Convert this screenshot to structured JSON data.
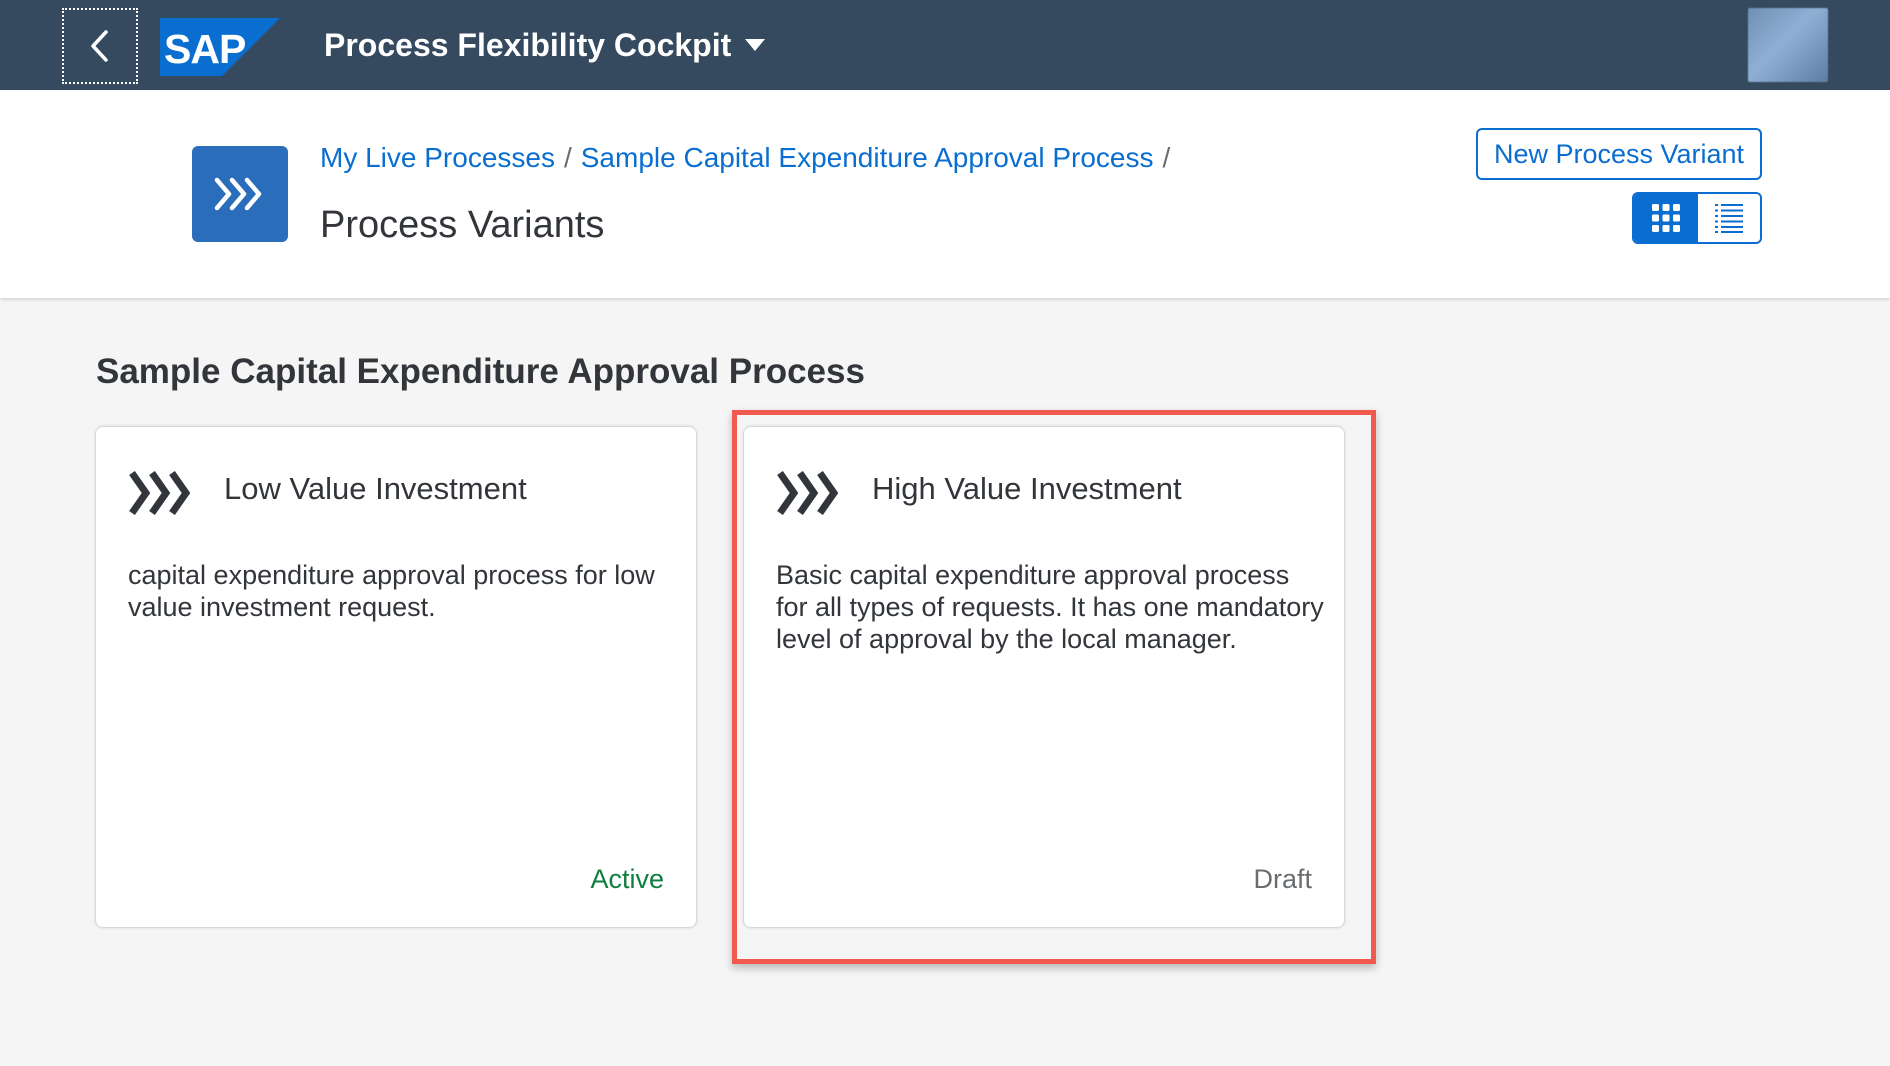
{
  "shell": {
    "app_title": "Process Flexibility Cockpit",
    "logo_text": "SAP",
    "colors": {
      "background": "#354a5f",
      "logo": "#0a6ed1"
    }
  },
  "header": {
    "breadcrumbs": [
      {
        "label": "My Live Processes"
      },
      {
        "label": "Sample Capital Expenditure Approval Process"
      }
    ],
    "separator": "/",
    "page_title": "Process Variants",
    "new_button_label": "New Process Variant",
    "view_toggle": {
      "selected": "grid",
      "options": [
        "grid",
        "list"
      ]
    }
  },
  "content": {
    "section_title": "Sample Capital Expenditure Approval Process",
    "cards": [
      {
        "title": "Low Value Investment",
        "description": "capital expenditure approval process for low value investment request.",
        "status": "Active",
        "icon": "process-arrows-icon"
      },
      {
        "title": "High Value Investment",
        "description": "Basic capital expenditure approval process for all types of requests. It has one mandatory level of approval by the local manager.",
        "status": "Draft",
        "icon": "process-arrows-icon",
        "highlighted": true
      }
    ]
  },
  "colors": {
    "accent": "#0a6ed1",
    "active_status": "#107e3e",
    "draft_status": "#6a6d70",
    "highlight": "#f15a4e"
  }
}
